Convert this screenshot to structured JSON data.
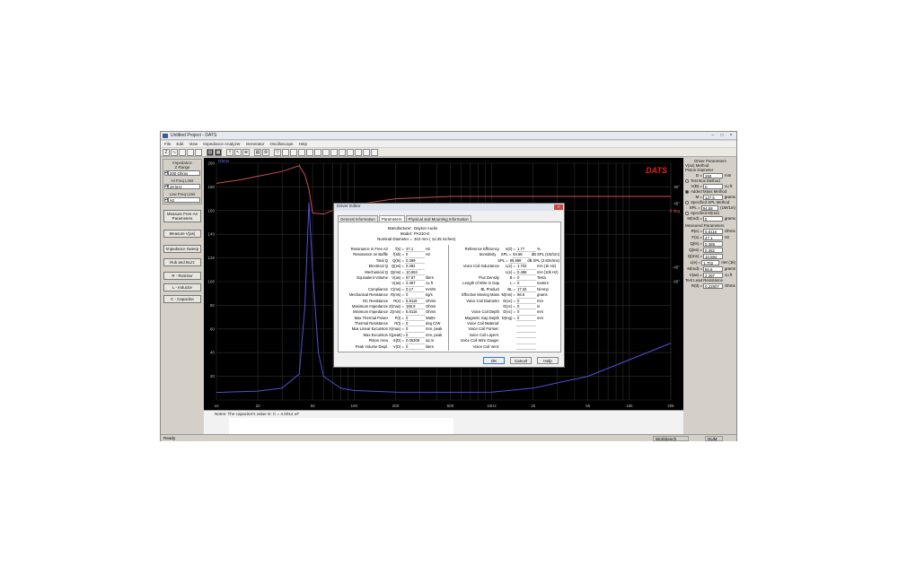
{
  "window": {
    "title": "Untitled Project - DATS",
    "controls": [
      "–",
      "□",
      "×"
    ]
  },
  "menu": [
    "File",
    "Edit",
    "View",
    "Impedance Analyzer",
    "Generator",
    "Oscilloscope",
    "Help"
  ],
  "toolbar": {
    "first_label": "Z"
  },
  "left_panel": {
    "impedance_label": "Impedance",
    "z_range_label": "Z Range",
    "z_range_value": "200 Ohms",
    "hi_freq_label": "Hi Freq Limit",
    "hi_freq_value": "20 kHz",
    "low_freq_label": "Low Freq Limit",
    "low_freq_value": "Hz",
    "buttons": [
      "Measure Free-Air Parameters",
      "Measure V(as)",
      "Impedance Sweep",
      "Rub and Buzz",
      "R - Resistor",
      "L - Inductor",
      "C - Capacitor"
    ]
  },
  "chart_data": {
    "type": "line",
    "brand": "DATS",
    "brand_color": "#e02020",
    "background": "#000000",
    "grid": true,
    "x_scale": "log",
    "xlim": [
      10,
      20000
    ],
    "x_ticks": [
      "10",
      "20",
      "50",
      "100",
      "200",
      "500",
      "1kHz",
      "2k",
      "5k",
      "10k",
      "20k"
    ],
    "ylim": [
      0,
      200
    ],
    "y_ticks": [
      "200",
      "180",
      "160",
      "140",
      "120",
      "100",
      "80",
      "60",
      "40",
      "20"
    ],
    "y_unit_label": "Ohms",
    "phase_ticks": [
      "90°",
      "45°",
      "0 deg",
      "-45°",
      "-90°"
    ],
    "series": [
      {
        "color": "#c85050",
        "x": [
          10,
          15,
          20,
          30,
          40,
          44,
          47,
          50,
          60,
          80,
          100,
          200,
          500,
          1000,
          2000,
          5000,
          10000,
          20000
        ],
        "y": [
          183,
          186,
          189,
          193,
          198,
          190,
          178,
          158,
          157,
          163,
          165,
          170,
          172,
          172,
          172,
          172,
          172,
          172
        ]
      },
      {
        "color": "#5050d8",
        "x": [
          10,
          20,
          30,
          40,
          44,
          47,
          50,
          55,
          60,
          80,
          100,
          200,
          500,
          1000,
          2000,
          5000,
          10000,
          20000
        ],
        "y": [
          6.4,
          7.5,
          10,
          22,
          80,
          166.9,
          110,
          40,
          20,
          10,
          8,
          6.6,
          6.5,
          6.7,
          10,
          20,
          34,
          48
        ]
      }
    ]
  },
  "notes": {
    "text": "Notes:  The capacitor's value is:   C = 4.0014 uF"
  },
  "right_panel": {
    "driver_parameters": "Driver Parameters",
    "vas_method": "V(as) Method",
    "piston_diameter": "Piston Diameter",
    "D_label": "D =",
    "D_value": "260",
    "D_unit": "mm",
    "test_box": "Test Box Method",
    "Vb_label": "V(B) =",
    "Vb_value": "0",
    "Vb_unit": "cu ft",
    "added_mass": "Added Mass Method",
    "M_label": "M =",
    "M_value": "127.5",
    "M_unit": "grams",
    "specified_spl": "Specified SPL Method",
    "SPL_label": "SPL =",
    "SPL_value": "94.58",
    "SPL_unit": "(1W/1m)",
    "specified_mmd": "Specified M(md)",
    "Mmd_label": "M(md) =",
    "Mmd_value": "0",
    "Mmd_unit": "grams",
    "measured": "Measured Parameters",
    "measured_rows": [
      {
        "k": "R(e) =",
        "v": "5.8116",
        "u": "Ohms"
      },
      {
        "k": "F(s) =",
        "v": "47.1",
        "u": "Hz"
      },
      {
        "k": "Q(ts) =",
        "v": "0.369",
        "u": ""
      },
      {
        "k": "Q(es) =",
        "v": "0.382",
        "u": ""
      },
      {
        "k": "Q(ms) =",
        "v": "10.594",
        "u": ""
      },
      {
        "k": "L(e) =",
        "v": "1.702",
        "u": "mH (1k)"
      },
      {
        "k": "M(md) =",
        "v": "66.6",
        "u": "grams"
      },
      {
        "k": "V(as) =",
        "v": "2.397",
        "u": "cu ft"
      }
    ],
    "test_lead": "Test Lead Resistance",
    "Rtl_label": "R(tl) =",
    "Rtl_value": "0.22807",
    "Rtl_unit": "Ohms"
  },
  "status": {
    "ready": "Ready",
    "workbench": "Workbench",
    "num": "NUM"
  },
  "dialog": {
    "title": "Driver Editor",
    "close": "×",
    "tabs": [
      "General Information",
      "Parameters",
      "Physical and Mounting Information"
    ],
    "active_tab": "Parameters",
    "header": [
      {
        "k": "Manufacturer:",
        "v": "Dayton Audio"
      },
      {
        "k": "Model:",
        "v": "PA310-8"
      },
      {
        "k": "Nominal Diameter =",
        "v": "310    mm    ( 12.25    inches)"
      }
    ],
    "left": [
      {
        "k": "Resonance in Free Air",
        "s": "f(s) =",
        "v": "47.1",
        "u": "Hz"
      },
      {
        "k": "Resonance on Baffle",
        "s": "f(sb) =",
        "v": "0",
        "u": "Hz"
      },
      {
        "k": "Total Q",
        "s": "Q(ts) =",
        "v": "0.369",
        "u": ""
      },
      {
        "k": "Electrical Q",
        "s": "Q(es) =",
        "v": "0.382",
        "u": ""
      },
      {
        "k": "Mechanical Q",
        "s": "Q(ms) =",
        "v": "10.594",
        "u": ""
      },
      {
        "k": "Equivalent Volume",
        "s": "V(as) =",
        "v": "67.87",
        "u": "liters"
      },
      {
        "k": "",
        "s": "V(as) =",
        "v": "2.397",
        "u": "cu ft"
      },
      {
        "k": "Compliance",
        "s": "C(ms) =",
        "v": "0.17",
        "u": "mm/N"
      },
      {
        "k": "Mechanical Resistance",
        "s": "R(ms) =",
        "v": "0",
        "u": "kg/s"
      },
      {
        "k": "DC Resistance",
        "s": "R(e) =",
        "v": "5.8116",
        "u": "Ohms"
      },
      {
        "k": "Maximum Impedance",
        "s": "Z(max) =",
        "v": "166.9",
        "u": "Ohms"
      },
      {
        "k": "Minimum Impedance",
        "s": "Z(min) =",
        "v": "5.8116",
        "u": "Ohms"
      },
      {
        "k": "Max Thermal Power",
        "s": "P(t) =",
        "v": "0",
        "u": "Watts"
      },
      {
        "k": "Thermal Resistance",
        "s": "R(t) =",
        "v": "0",
        "u": "deg C/W"
      },
      {
        "k": "Max Linear Excursion",
        "s": "X(max) =",
        "v": "0",
        "u": "mm, peak"
      },
      {
        "k": "Max Excursion",
        "s": "X(peak) =",
        "v": "0",
        "u": "mm, peak"
      },
      {
        "k": "Piston Area",
        "s": "S(D) =",
        "v": "0.05309",
        "u": "sq m"
      },
      {
        "k": "Peak Volume Displ.",
        "s": "V(D) =",
        "v": "0",
        "u": "liters"
      }
    ],
    "right": [
      {
        "k": "Reference Efficiency",
        "s": "n(0) =",
        "v": "1.77",
        "u": "%"
      },
      {
        "k": "Sensitivity",
        "s": "SPL =",
        "v": "94.58",
        "u": "dB SPL (1W/1m)"
      },
      {
        "k": "",
        "s": "SPL =",
        "v": "95.988",
        "u": "dB SPL (2.83Vrms)"
      },
      {
        "k": "Voice Coil Inductance",
        "s": "L(e) =",
        "v": "1.702",
        "u": "mH (1k Hz)"
      },
      {
        "k": "",
        "s": "L(e) =",
        "v": "0.486",
        "u": "mH (10k Hz)"
      },
      {
        "k": "Flux Density",
        "s": "B =",
        "v": "0",
        "u": "Tesla"
      },
      {
        "k": "Length of Wire in Gap",
        "s": "L =",
        "v": "0",
        "u": "meters"
      },
      {
        "k": "BL Product",
        "s": "BL =",
        "v": "17.32",
        "u": "N/Amp"
      },
      {
        "k": "Effective Moving Mass",
        "s": "M(ms) =",
        "v": "66.6",
        "u": "grams"
      },
      {
        "k": "Voice Coil Diameter",
        "s": "D(vc) =",
        "v": "0",
        "u": "mm"
      },
      {
        "k": "",
        "s": "D(vc) =",
        "v": "0",
        "u": "in"
      },
      {
        "k": "Voice Coil Depth",
        "s": "D(vc) =",
        "v": "0",
        "u": "mm"
      },
      {
        "k": "Magnetic Gap Depth",
        "s": "D(mg) =",
        "v": "0",
        "u": "mm"
      },
      {
        "k": "Voice Coil Material:",
        "s": "",
        "v": "",
        "u": ""
      },
      {
        "k": "Voice Coil Former:",
        "s": "",
        "v": "",
        "u": ""
      },
      {
        "k": "Voice Coil Layers:",
        "s": "",
        "v": "",
        "u": ""
      },
      {
        "k": "Voice Coil Wire Gauge:",
        "s": "",
        "v": "",
        "u": ""
      },
      {
        "k": "Voice Coil Vent:",
        "s": "",
        "v": "",
        "u": ""
      }
    ],
    "buttons": [
      "OK",
      "Cancel",
      "Help"
    ]
  }
}
